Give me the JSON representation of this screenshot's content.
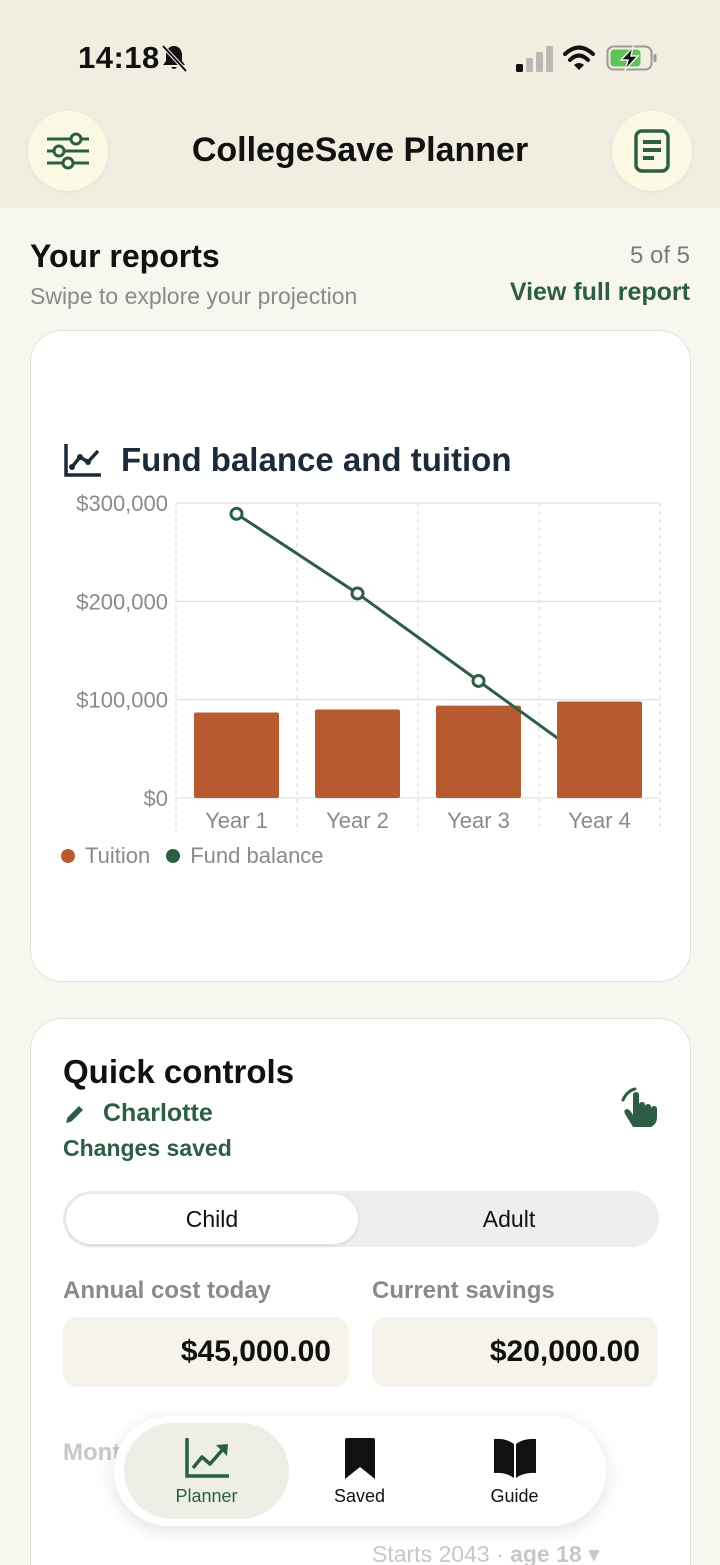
{
  "status_bar": {
    "time": "14:18",
    "icons": [
      "bell-slash-icon",
      "signal-icon",
      "wifi-icon",
      "battery-charging-icon"
    ]
  },
  "header": {
    "title": "CollegeSave Planner",
    "left_icon": "sliders-icon",
    "right_icon": "report-icon"
  },
  "reports": {
    "title": "Your reports",
    "subtitle": "Swipe to explore your projection",
    "page_count": "5 of 5",
    "view_link": "View full report"
  },
  "chart_card": {
    "icon": "line-chart-icon",
    "title": "Fund balance and tuition"
  },
  "chart_data": {
    "type": "bar",
    "title": "Fund balance and tuition",
    "categories": [
      "Year 1",
      "Year 2",
      "Year 3",
      "Year 4"
    ],
    "y_ticks": [
      "$300,000",
      "$200,000",
      "$100,000",
      "$0"
    ],
    "ylim": [
      0,
      300000
    ],
    "series": [
      {
        "name": "Tuition",
        "type": "bar",
        "color": "#b85a2f",
        "values": [
          87000,
          90000,
          94000,
          98000
        ]
      },
      {
        "name": "Fund balance",
        "type": "line",
        "color": "#2c5e45",
        "values": [
          289000,
          208000,
          119000,
          30000
        ]
      }
    ],
    "grid": true,
    "legend": "bottom-left"
  },
  "controls": {
    "title": "Quick controls",
    "name": "Charlotte",
    "saved_status": "Changes saved",
    "segments": [
      "Child",
      "Adult"
    ],
    "selected_segment": "Child",
    "annual_cost_label": "Annual cost today",
    "annual_cost_value": "$45,000.00",
    "savings_label": "Current savings",
    "savings_value": "$20,000.00",
    "monthly_label": "Mont",
    "starts_text": "Starts 2043 ·",
    "starts_age": "age 18",
    "starts_caret": "▾"
  },
  "nav": {
    "items": [
      {
        "label": "Planner",
        "icon": "trending-chart-icon",
        "active": true
      },
      {
        "label": "Saved",
        "icon": "bookmark-icon",
        "active": false
      },
      {
        "label": "Guide",
        "icon": "book-icon",
        "active": false
      }
    ]
  },
  "colors": {
    "accent_green": "#2c5e45",
    "tuition_orange": "#b85a2f",
    "background": "#f7f6ef"
  }
}
